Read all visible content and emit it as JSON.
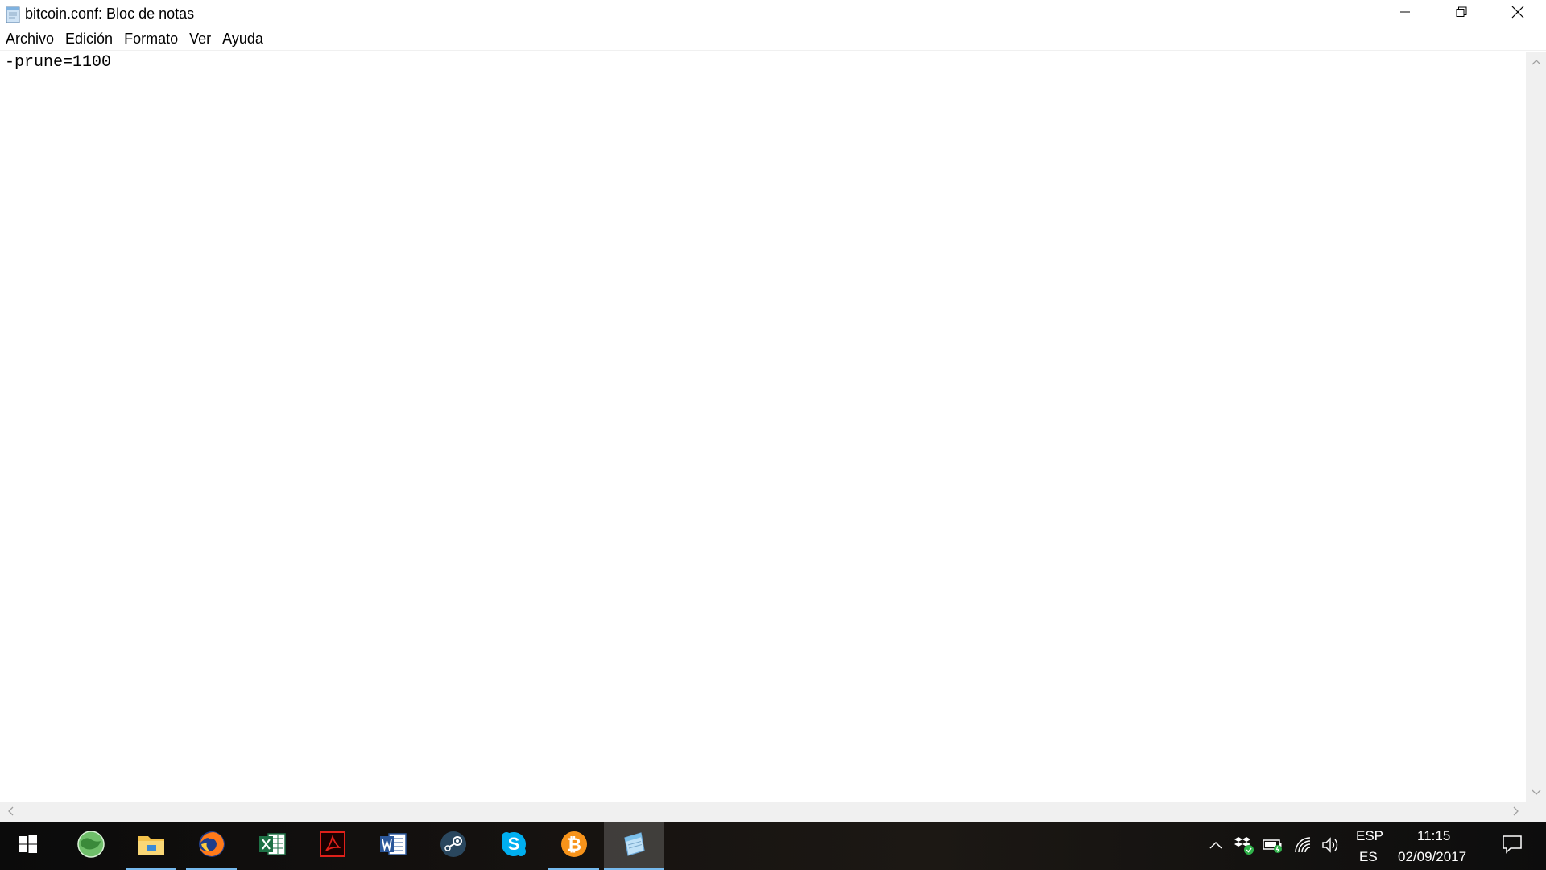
{
  "window": {
    "title": "bitcoin.conf: Bloc de notas",
    "icon": "notepad-icon",
    "buttons": [
      "minimize-icon",
      "restore-icon",
      "close-icon"
    ]
  },
  "menu": {
    "items": [
      {
        "label": "Archivo"
      },
      {
        "label": "Edición"
      },
      {
        "label": "Formato"
      },
      {
        "label": "Ver"
      },
      {
        "label": "Ayuda"
      }
    ]
  },
  "editor": {
    "content": "-prune=1100"
  },
  "taskbar": {
    "start_icon": "windows-logo-icon",
    "apps": [
      {
        "name": "globe-app-icon",
        "running": false
      },
      {
        "name": "file-explorer-icon",
        "running": true
      },
      {
        "name": "firefox-icon",
        "running": true
      },
      {
        "name": "excel-icon",
        "running": false
      },
      {
        "name": "acrobat-icon",
        "running": false
      },
      {
        "name": "word-icon",
        "running": false
      },
      {
        "name": "steam-icon",
        "running": false
      },
      {
        "name": "skype-icon",
        "running": false
      },
      {
        "name": "bitcoin-icon",
        "running": true
      },
      {
        "name": "notepad-icon",
        "running": true,
        "active": true
      }
    ],
    "tray": {
      "language_top": "ESP",
      "language_bottom": "ES",
      "time": "11:15",
      "date": "02/09/2017"
    }
  },
  "colors": {
    "taskbar_running": "#76b9ed",
    "scrollbar_bg": "#f0f0f0",
    "close_hover": "#e81123"
  }
}
